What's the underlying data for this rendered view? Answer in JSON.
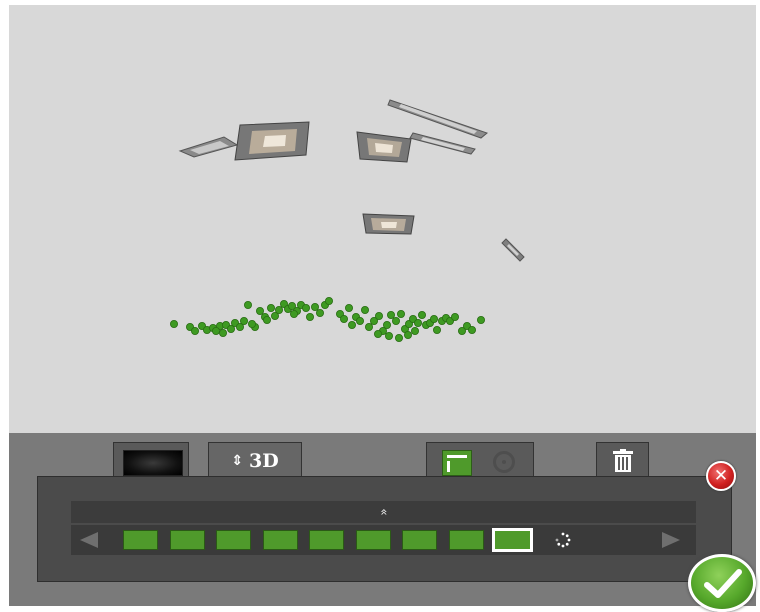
{
  "toolbar": {
    "mode_tab_label": "3D",
    "mode_tab_arrows": "⇕"
  },
  "strip": {
    "collapse_glyph": "»",
    "frame_count": 9,
    "selected_frame_index": 8
  },
  "buttons": {
    "close_glyph": "✕"
  },
  "colors": {
    "viewport_bg": "#d8d8d8",
    "panel_bg": "#7a7a7a",
    "accent_green": "#4f9a2b",
    "close_red": "#d02020"
  },
  "icons": [
    "photo-thumbnail-icon",
    "up-down-arrows-icon",
    "view-panel-icon",
    "orbit-icon",
    "trash-icon",
    "close-icon",
    "expand-up-icon",
    "arrow-left-icon",
    "arrow-right-icon",
    "loading-icon",
    "checkmark-icon"
  ]
}
